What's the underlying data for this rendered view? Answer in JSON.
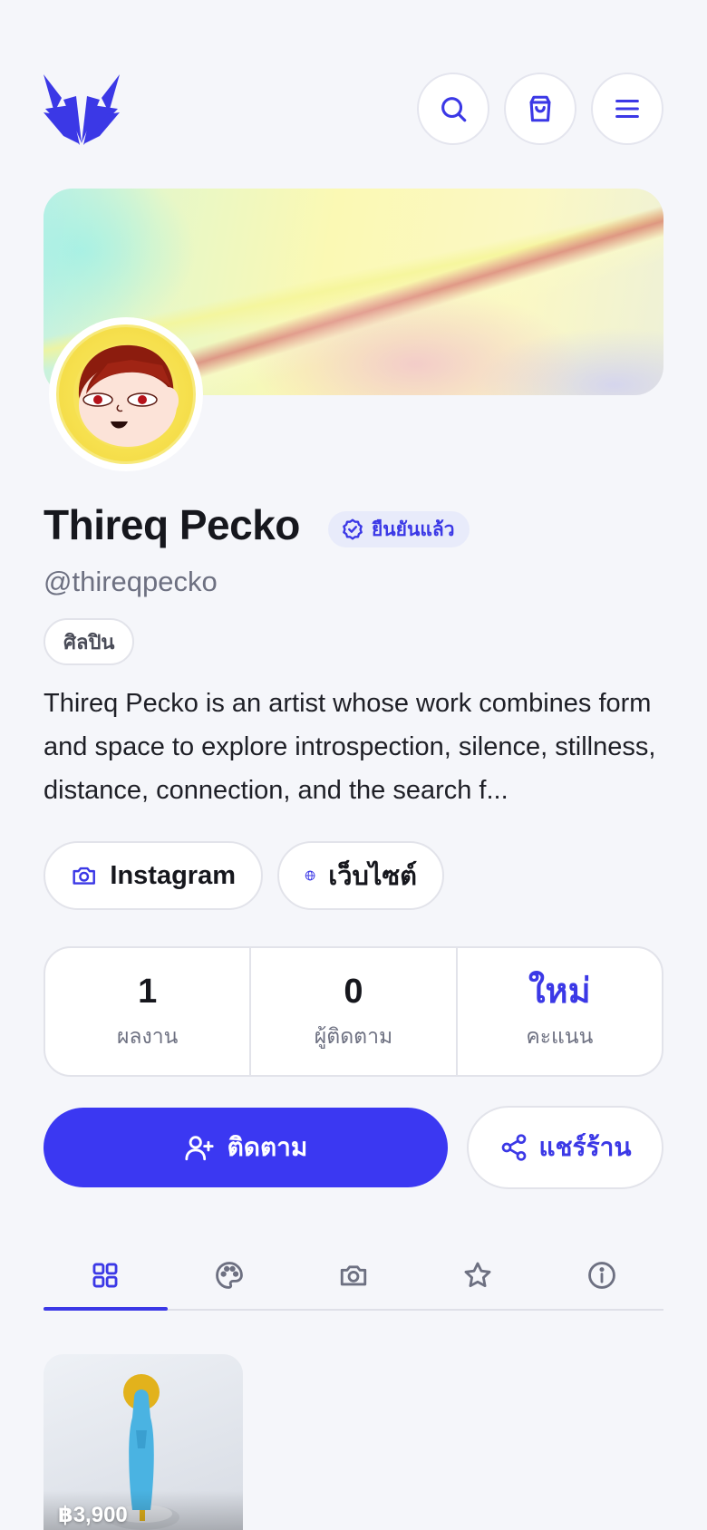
{
  "header": {
    "logo_name": "fox-logo",
    "search_icon": "search-icon",
    "cart_icon": "shopping-bag-icon",
    "menu_icon": "menu-icon"
  },
  "profile": {
    "name": "Thireq Pecko",
    "verified_label": "ยืนยันแล้ว",
    "handle": "@thireqpecko",
    "category": "ศิลปิน",
    "bio": "Thireq Pecko is an artist whose work combines form and space to explore introspection, silence, stillness, distance, connection, and the search f..."
  },
  "links": [
    {
      "icon": "camera-icon",
      "label": "Instagram"
    },
    {
      "icon": "globe-icon",
      "label": "เว็บไซต์"
    }
  ],
  "stats": [
    {
      "value": "1",
      "label": "ผลงาน"
    },
    {
      "value": "0",
      "label": "ผู้ติดตาม"
    },
    {
      "value": "ใหม่",
      "label": "คะแนน"
    }
  ],
  "actions": {
    "follow_label": "ติดตาม",
    "share_label": "แชร์ร้าน"
  },
  "tabs": [
    {
      "icon": "grid-icon",
      "active": true
    },
    {
      "icon": "palette-icon",
      "active": false
    },
    {
      "icon": "camera-icon",
      "active": false
    },
    {
      "icon": "star-icon",
      "active": false
    },
    {
      "icon": "info-icon",
      "active": false
    }
  ],
  "products": [
    {
      "price": "฿3,900"
    }
  ],
  "colors": {
    "accent": "#3b38e6",
    "background": "#f5f6fa"
  }
}
